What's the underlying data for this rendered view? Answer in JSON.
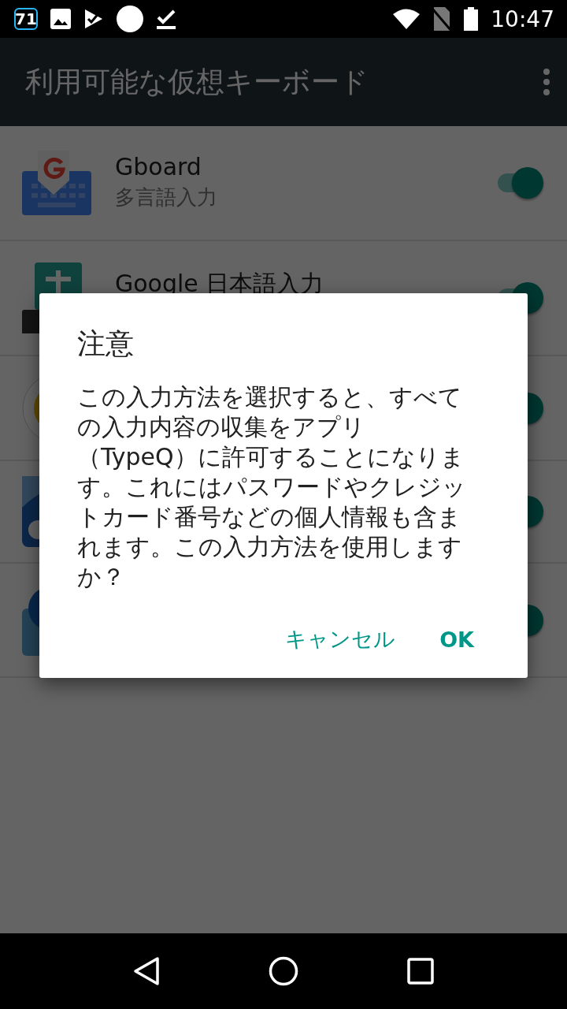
{
  "status_bar": {
    "badge": "71",
    "time": "10:47"
  },
  "app_bar": {
    "title": "利用可能な仮想キーボード"
  },
  "keyboards": [
    {
      "kind": "gboard",
      "title": "Gboard",
      "subtitle": "多言語入力",
      "on": true
    },
    {
      "kind": "japanese",
      "title": "Google 日本語入力",
      "on": true
    },
    {
      "kind": "round",
      "on": true
    },
    {
      "kind": "cloud",
      "on": true
    },
    {
      "kind": "bubble",
      "on": true
    }
  ],
  "dialog": {
    "title": "注意",
    "message": "この入力方法を選択すると、すべての入力内容の収集をアプリ（TypeQ）に許可することになります。これにはパスワードやクレジットカード番号などの個人情報も含まれます。この入力方法を使用しますか？",
    "buttons": [
      "キャンセル",
      "OK"
    ]
  }
}
